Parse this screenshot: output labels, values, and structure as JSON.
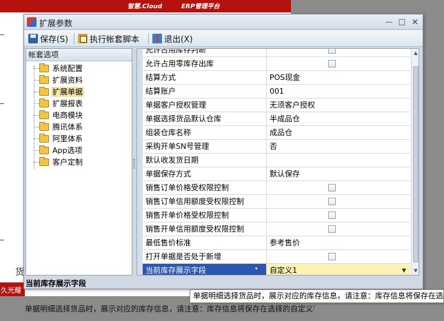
{
  "background": {
    "brand_left": "智慧.Cloud",
    "brand_right": "ERP管理平台",
    "red_label": "久光耀",
    "left_mark": "货"
  },
  "dialog": {
    "title": "扩展参数",
    "window_buttons": {
      "minimize": "—",
      "maximize": "□",
      "close": "✕"
    }
  },
  "toolbar": {
    "save_label": "保存(S)",
    "run_script_label": "执行帐套脚本",
    "exit_label": "退出(X)"
  },
  "left_panel": {
    "header": "帐套选项",
    "items": [
      {
        "label": "系统配置",
        "selected": false
      },
      {
        "label": "扩展资料",
        "selected": false
      },
      {
        "label": "扩展单据",
        "selected": true
      },
      {
        "label": "扩展报表",
        "selected": false
      },
      {
        "label": "电商模块",
        "selected": false
      },
      {
        "label": "腾讯体系",
        "selected": false
      },
      {
        "label": "阿里体系",
        "selected": false
      },
      {
        "label": "App选项",
        "selected": false
      },
      {
        "label": "客户定制",
        "selected": false
      }
    ]
  },
  "properties": [
    {
      "name": "允许占用库存判断",
      "value": "",
      "checkbox": true
    },
    {
      "name": "允许占用零库存出库",
      "value": "",
      "checkbox": true
    },
    {
      "name": "结算方式",
      "value": "POS现金",
      "checkbox": false
    },
    {
      "name": "结算账户",
      "value": "001",
      "checkbox": false
    },
    {
      "name": "单据客户授权管理",
      "value": "无须客户授权",
      "checkbox": false
    },
    {
      "name": "单据选择货品默认仓库",
      "value": "半成品仓",
      "checkbox": false
    },
    {
      "name": "组装仓库名称",
      "value": "成品仓",
      "checkbox": false
    },
    {
      "name": "采购开单SN号管理",
      "value": "否",
      "checkbox": false
    },
    {
      "name": "默认收发货日期",
      "value": "",
      "checkbox": false
    },
    {
      "name": "单据保存方式",
      "value": "默认保存",
      "checkbox": false
    },
    {
      "name": "销售订单价格受权限控制",
      "value": "",
      "checkbox": true
    },
    {
      "name": "销售订单信用额度受权限控制",
      "value": "",
      "checkbox": true
    },
    {
      "name": "销售开单价格受权限控制",
      "value": "",
      "checkbox": true
    },
    {
      "name": "销售开单信用额度受权限控制",
      "value": "",
      "checkbox": true
    },
    {
      "name": "最低售价标准",
      "value": "参考售价",
      "checkbox": false
    },
    {
      "name": "打开单据是否处于新增",
      "value": "",
      "checkbox": true
    },
    {
      "name": "当前库存展示字段",
      "value": "自定义1",
      "checkbox": false,
      "active": true
    }
  ],
  "description": {
    "title": "当前库存展示字段",
    "text": "单据明细选择货品时，展示对应的库存信息，请注意：库存信息将保存在选择的自定义字段中"
  },
  "tooltip": {
    "text": "单据明细选择货品时，展示对应的库存信息，请注意：库存信息将保存在选择的"
  }
}
